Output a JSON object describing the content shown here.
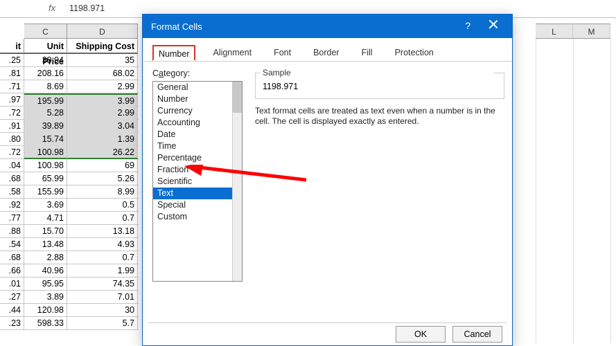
{
  "formula_bar": {
    "fx": "fx",
    "value": "1198.971"
  },
  "columns": {
    "C": "C",
    "D": "D",
    "L": "L",
    "M": "M"
  },
  "headers": {
    "B": "it",
    "C": "Unit Price",
    "D": "Shipping Cost"
  },
  "rows": [
    {
      "b": ".25",
      "c": "38.94",
      "d": "35"
    },
    {
      "b": ".81",
      "c": "208.16",
      "d": "68.02"
    },
    {
      "b": ".71",
      "c": "8.69",
      "d": "2.99"
    },
    {
      "b": ".97",
      "c": "195.99",
      "d": "3.99"
    },
    {
      "b": ".72",
      "c": "5.28",
      "d": "2.99"
    },
    {
      "b": ".91",
      "c": "39.89",
      "d": "3.04"
    },
    {
      "b": ".80",
      "c": "15.74",
      "d": "1.39"
    },
    {
      "b": ".72",
      "c": "100.98",
      "d": "26.22"
    },
    {
      "b": ".04",
      "c": "100.98",
      "d": "69"
    },
    {
      "b": ".68",
      "c": "65.99",
      "d": "5.26"
    },
    {
      "b": ".58",
      "c": "155.99",
      "d": "8.99"
    },
    {
      "b": ".92",
      "c": "3.69",
      "d": "0.5"
    },
    {
      "b": ".77",
      "c": "4.71",
      "d": "0.7"
    },
    {
      "b": ".88",
      "c": "15.70",
      "d": "13.18"
    },
    {
      "b": ".54",
      "c": "13.48",
      "d": "4.93"
    },
    {
      "b": ".68",
      "c": "2.88",
      "d": "0.7"
    },
    {
      "b": ".66",
      "c": "40.96",
      "d": "1.99"
    },
    {
      "b": ".01",
      "c": "95.95",
      "d": "74.35"
    },
    {
      "b": ".27",
      "c": "3.89",
      "d": "7.01"
    },
    {
      "b": ".44",
      "c": "120.98",
      "d": "30"
    },
    {
      "b": ".23",
      "c": "598.33",
      "d": "5.7"
    }
  ],
  "selected_rows_start": 3,
  "selected_rows_end": 7,
  "dialog": {
    "title": "Format Cells",
    "tabs": [
      "Number",
      "Alignment",
      "Font",
      "Border",
      "Fill",
      "Protection"
    ],
    "active_tab": 0,
    "category_label_pre": "C",
    "category_label_u": "a",
    "category_label_post": "tegory:",
    "categories": [
      "General",
      "Number",
      "Currency",
      "Accounting",
      "Date",
      "Time",
      "Percentage",
      "Fraction",
      "Scientific",
      "Text",
      "Special",
      "Custom"
    ],
    "selected_category": 9,
    "sample_label": "Sample",
    "sample_value": "1198.971",
    "description": "Text format cells are treated as text even when a number is in the cell. The cell is displayed exactly as entered.",
    "ok": "OK",
    "cancel": "Cancel",
    "help": "?"
  }
}
